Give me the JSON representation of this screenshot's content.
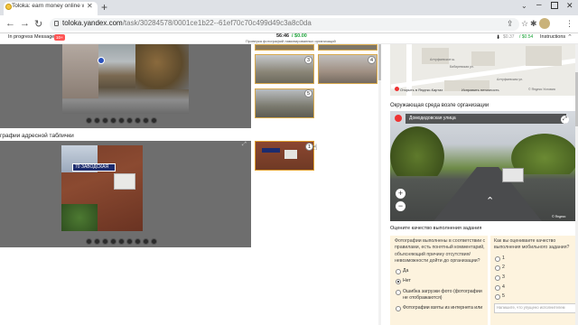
{
  "browser": {
    "tab_title": "Toloka: earn money online with ...",
    "url_host": "toloka.yandex.com",
    "url_path": "/task/30284578/0001ce1b22--61ef70c70c499d49c3a8c0da",
    "icons": [
      "back-icon",
      "forward-icon",
      "reload-icon",
      "lock-icon",
      "share-icon",
      "star-icon",
      "extension-icon",
      "profile-avatar",
      "menu-icon"
    ]
  },
  "toloka": {
    "in_progress": "In progress",
    "messages": "Messages",
    "messages_badge": "10+",
    "timer": "56:46",
    "reward": "/ $0.00",
    "subtitle": "Проверка фотографий ламинированных организаций",
    "balance": "$0.37",
    "balance2": "/ $0.54",
    "instructions": "Instructions"
  },
  "left": {
    "section_title": "графии адресной таблички",
    "sign_text": "70  ЗАВОДСКАЯ",
    "thumb_numbers": [
      "3",
      "4",
      "5",
      "1"
    ]
  },
  "right": {
    "map_labels": [
      "Алтуфьевское ш.",
      "Бибиревская ул.",
      "Алтуфьевская ул."
    ],
    "map_open": "Открыть в Яндекс.Картах",
    "map_fix": "Исправить неточность",
    "map_copyright": "© Яндекс Условия",
    "env_title": "Окружающая среда возле организации",
    "pano_label": "Домодедовская улица",
    "pano_copyright": "© Яндекс",
    "rate_title": "Оцените качество выполнения задания",
    "q1": "Фотографии выполнены в соответствии с правилами, есть понятный комментарий, объясняющий причину отсутствия/невозможности дойти до организации?",
    "q1_options": [
      "Да",
      "Нет",
      "Ошибка загрузки фото (фотографии не отображаются)",
      "Фотографии взяты из интернета или"
    ],
    "q1_selected": 1,
    "q2": "Как вы оцениваете качество выполнения мобильного задания?",
    "q2_options": [
      "1",
      "2",
      "3",
      "4",
      "5"
    ],
    "comment_placeholder": "Напишите, что упущено исполнителем"
  }
}
